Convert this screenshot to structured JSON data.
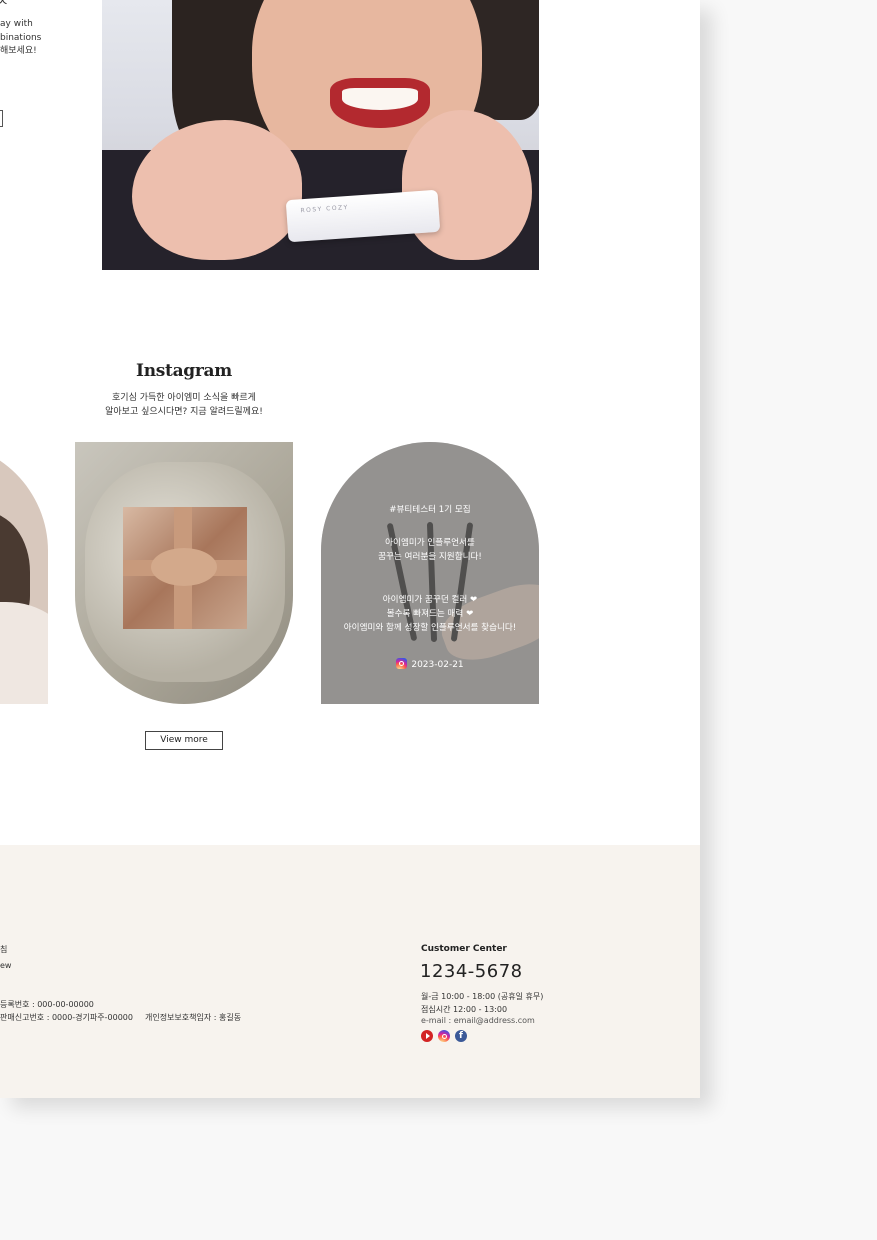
{
  "side": {
    "cut_char": "ㅈ",
    "line1": "ay with",
    "line2": "binations",
    "line3": "해보세요!"
  },
  "hero": {
    "product_brand": "ROSY COZY"
  },
  "instagram": {
    "title": "Instagram",
    "subtitle_line1": "호기심 가득한 아이엠미 소식을 빠르게",
    "subtitle_line2": "알아보고 싶으시다면? 지금 알려드릴께요!",
    "post": {
      "tag": "#뷰티테스터 1기 모집",
      "line2": "아이엠미가 인플루언서를",
      "line3": "꿈꾸는 여러분을 지원합니다!",
      "line4": "아이엠미가 꿈꾸던 컬러 ❤",
      "line5": "볼수록 빠져드는 매력 ❤",
      "line6": "아이엠미와 함께 성장할 인플루언서를 찾습니다!",
      "date": "2023-02-21"
    },
    "view_more": "View more"
  },
  "footer": {
    "left_line1": "침",
    "left_line2": "ew",
    "left_line3": " 등록번호 : 000-00-00000",
    "left_line4": "판매신고번호 : 0000-경기파주-00000",
    "privacy_officer": "개인정보보호책임자 : 홍길동",
    "cc_label": "Customer Center",
    "cc_phone": "1234-5678",
    "cc_hours": "월-금 10:00 - 18:00 (공휴일 휴무)",
    "cc_lunch": "점심시간 12:00 - 13:00",
    "cc_email": "e-mail : email@address.com",
    "social": [
      "youtube-icon",
      "instagram-icon",
      "facebook-icon"
    ],
    "fb_glyph": "f"
  },
  "colors": {
    "footer_bg": "#f7f3ee",
    "accent_lip": "#b3292f"
  }
}
